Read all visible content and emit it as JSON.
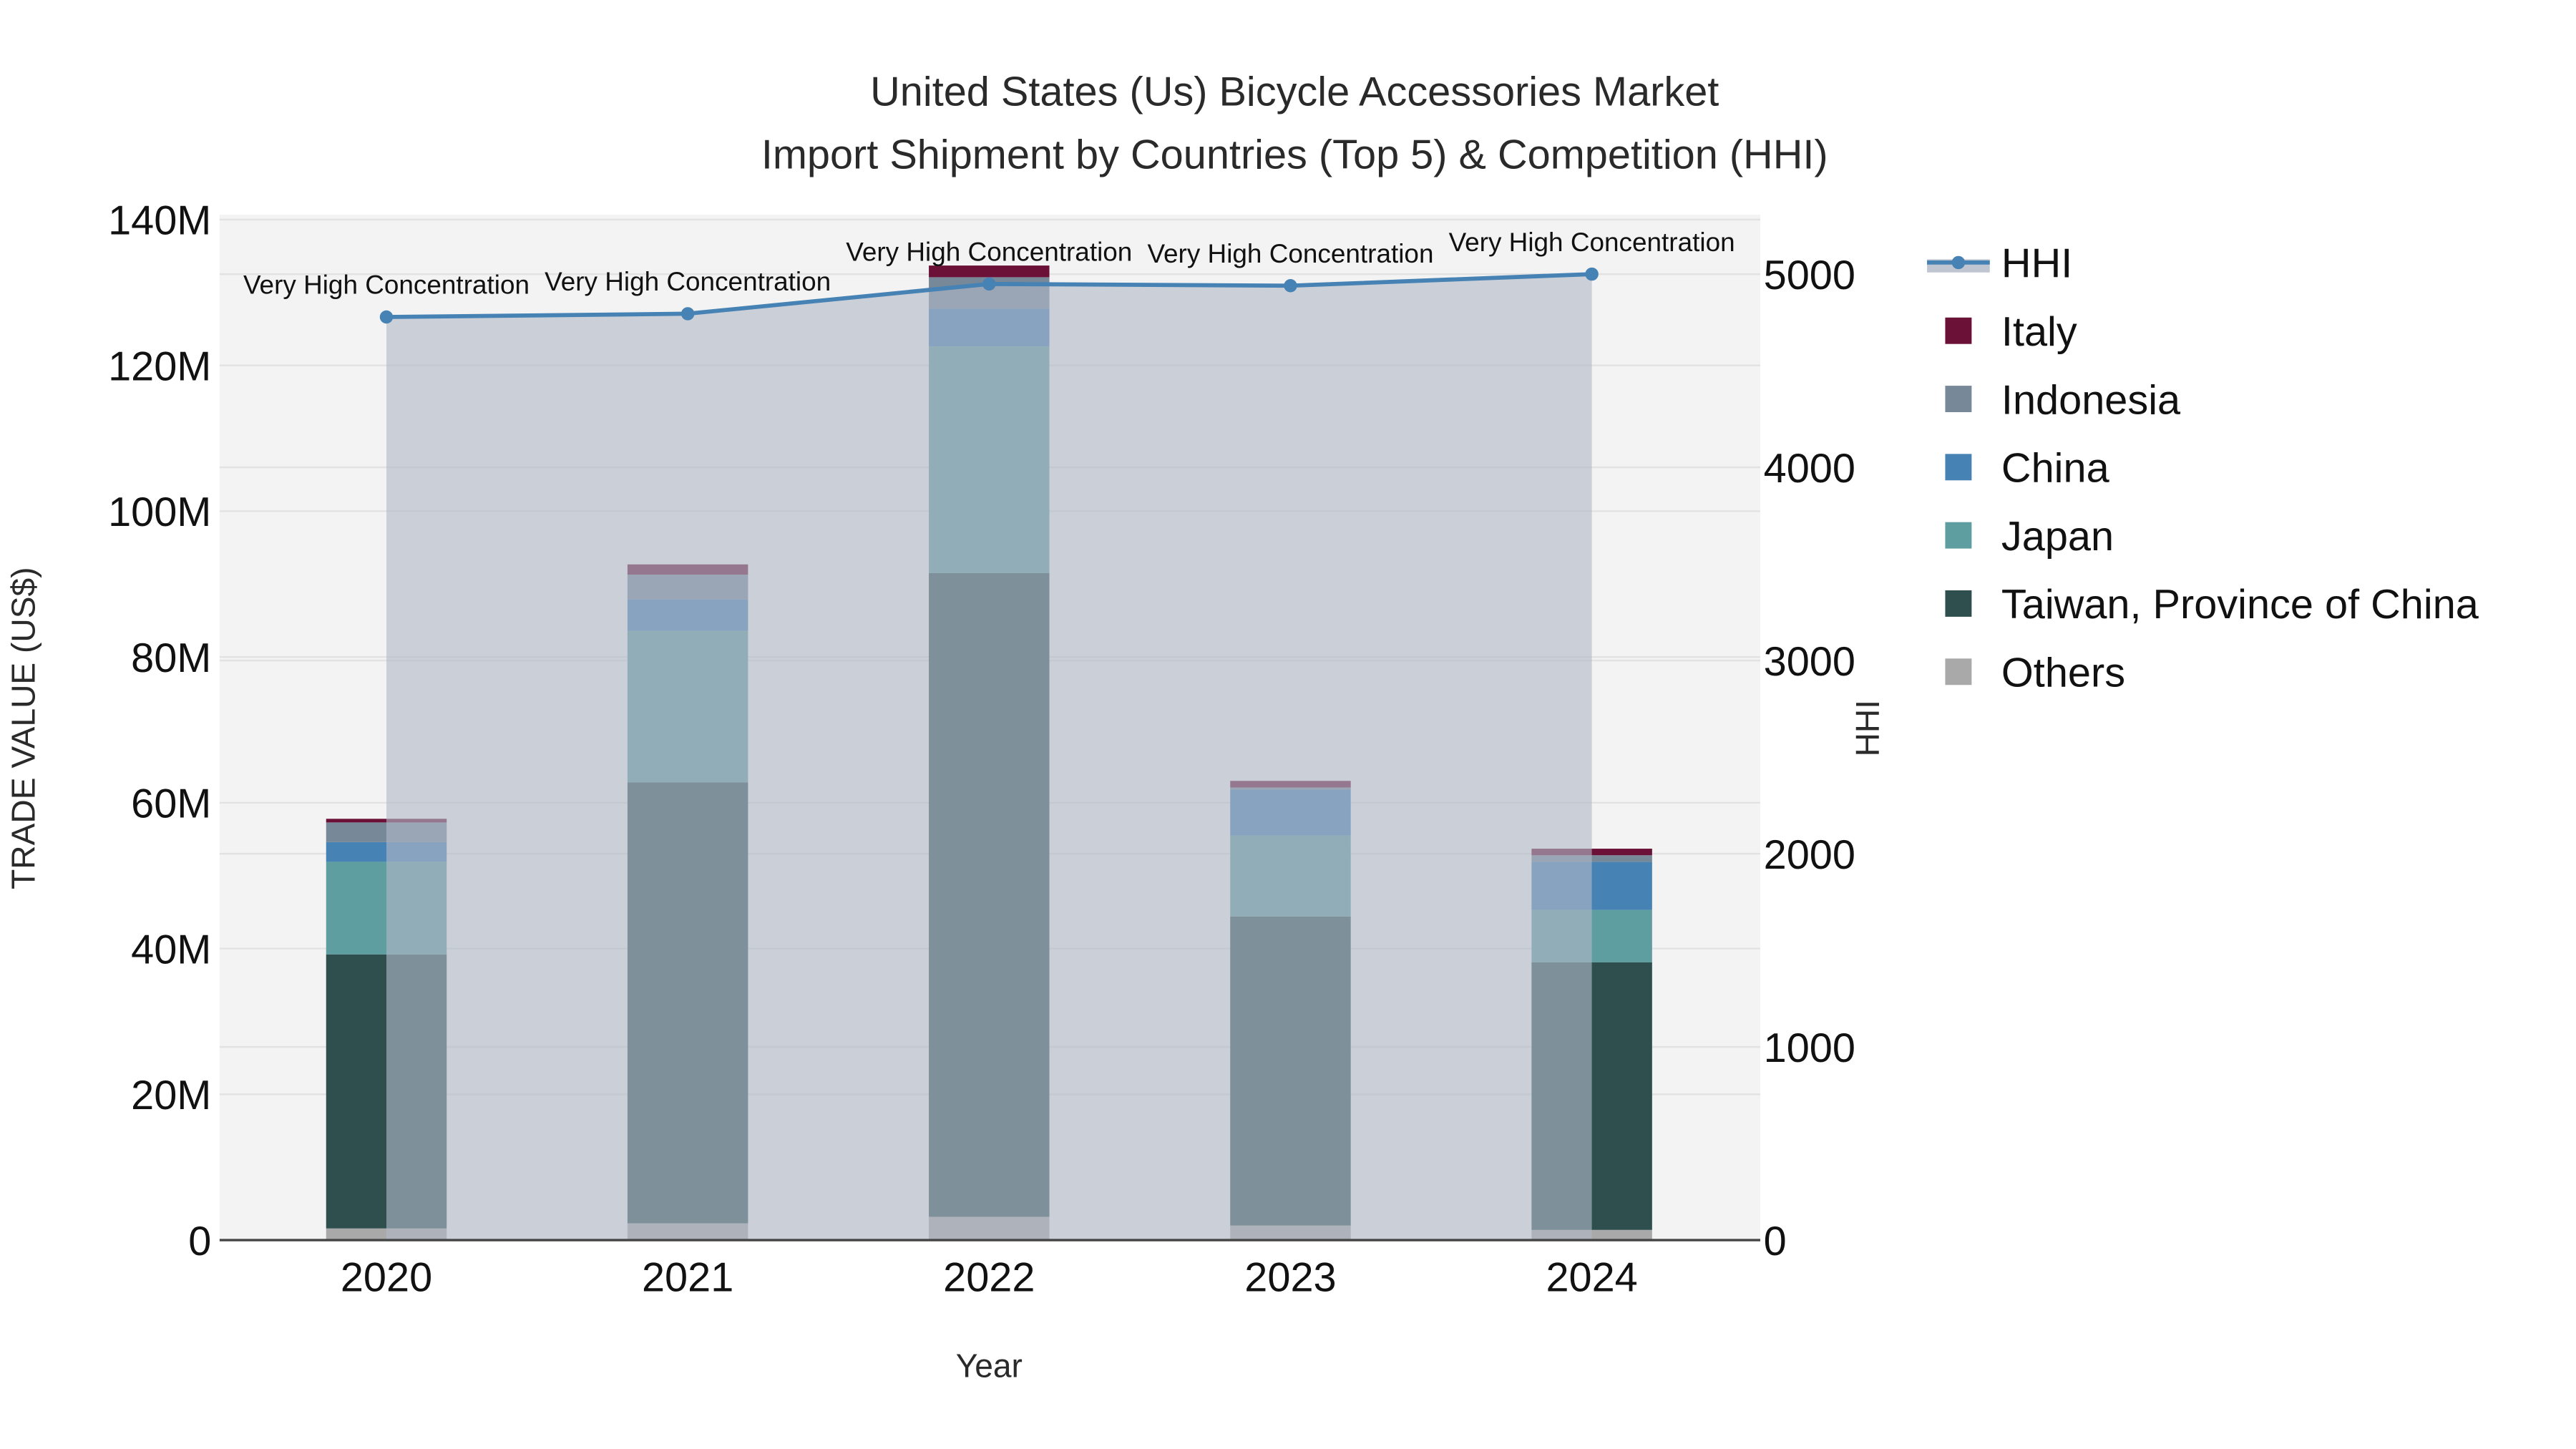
{
  "chart_data": {
    "type": "bar",
    "stacked": true,
    "title": "United States (Us) Bicycle Accessories Market",
    "subtitle": "Import Shipment by Countries (Top 5) & Competition (HHI)",
    "xlabel": "Year",
    "ylabel": "TRADE VALUE (US$)",
    "y2label": "HHI",
    "categories": [
      "2020",
      "2021",
      "2022",
      "2023",
      "2024"
    ],
    "ylim": [
      0,
      140000000
    ],
    "y2lim": [
      0,
      5280
    ],
    "yticks": [
      0,
      20000000,
      40000000,
      60000000,
      80000000,
      100000000,
      120000000,
      140000000
    ],
    "ytick_labels": [
      "0",
      "20M",
      "40M",
      "60M",
      "80M",
      "100M",
      "120M",
      "140M"
    ],
    "y2ticks": [
      0,
      1000,
      2000,
      3000,
      4000,
      5000
    ],
    "y2tick_labels": [
      "0",
      "1000",
      "2000",
      "3000",
      "4000",
      "5000"
    ],
    "series": [
      {
        "name": "Others",
        "color": "#A9A9A9",
        "values": [
          1600000,
          2300000,
          3200000,
          2000000,
          1400000
        ]
      },
      {
        "name": "Taiwan, Province of China",
        "color": "#2F4F4F",
        "values": [
          37600000,
          60500000,
          88300000,
          42400000,
          36700000
        ]
      },
      {
        "name": "Japan",
        "color": "#5F9EA0",
        "values": [
          12700000,
          20800000,
          31100000,
          11100000,
          7200000
        ]
      },
      {
        "name": "China",
        "color": "#4682B4",
        "values": [
          2700000,
          4300000,
          5200000,
          6300000,
          6600000
        ]
      },
      {
        "name": "Indonesia",
        "color": "#778899",
        "values": [
          2700000,
          3400000,
          4300000,
          300000,
          900000
        ]
      },
      {
        "name": "Italy",
        "color": "#6B1036",
        "values": [
          500000,
          1400000,
          1600000,
          900000,
          900000
        ]
      }
    ],
    "hhi": {
      "name": "HHI",
      "color": "#4682B4",
      "values": [
        4778,
        4795,
        4949,
        4940,
        5000
      ],
      "annotations": [
        "Very High Concentration",
        "Very High Concentration",
        "Very High Concentration",
        "Very High Concentration",
        "Very High Concentration"
      ]
    },
    "legend_order": [
      "HHI",
      "Italy",
      "Indonesia",
      "China",
      "Japan",
      "Taiwan, Province of China",
      "Others"
    ],
    "legend_position": "right",
    "grid": true
  }
}
